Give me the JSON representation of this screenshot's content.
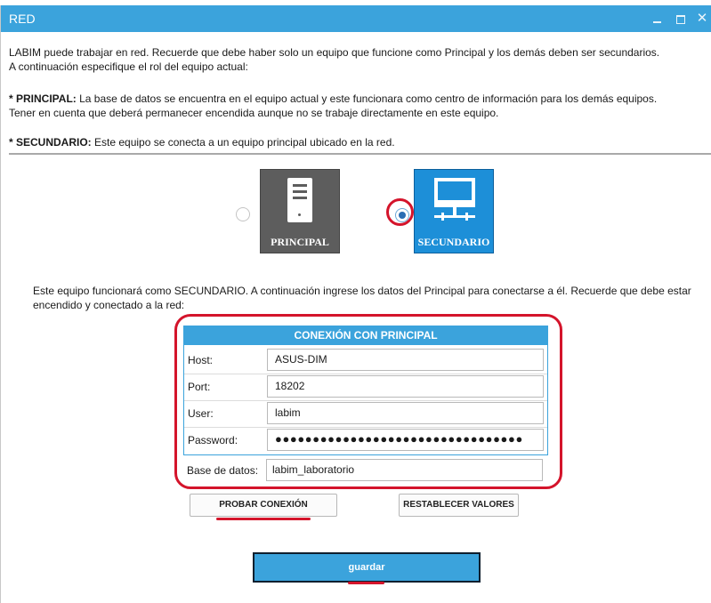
{
  "window": {
    "title": "RED",
    "minimize_icon": "minimize-icon",
    "maximize_icon": "maximize-icon",
    "close_label": "✕"
  },
  "intro": {
    "line1": "LABIM puede trabajar en red. Recuerde que debe haber solo un equipo que funcione como Principal y los demás deben ser secundarios.",
    "line2": "A continuación especifique el rol del equipo actual:"
  },
  "principal_desc": {
    "bold": "* PRINCIPAL:",
    "text1": " La base de datos se encuentra en el equipo actual y este funcionara como centro de información para los demás equipos.",
    "text2": "Tener en cuenta que deberá permanecer encendida aunque no se trabaje directamente en este equipo."
  },
  "secundario_desc": {
    "bold": "* SECUNDARIO:",
    "text": " Este equipo se conecta a un equipo principal ubicado en la red."
  },
  "roles": {
    "principal": {
      "label": "PRINCIPAL",
      "icon": "server-icon",
      "selected": false
    },
    "secundario": {
      "label": "SECUNDARIO",
      "icon": "monitor-network-icon",
      "selected": true
    }
  },
  "secondary_info": "Este equipo funcionará como SECUNDARIO. A continuación ingrese los datos del Principal para conectarse a él. Recuerde que debe estar encendido y conectado a la red:",
  "connection": {
    "header": "CONEXIÓN CON PRINCIPAL",
    "host_label": "Host:",
    "host_value": "ASUS-DIM",
    "port_label": "Port:",
    "port_value": "18202",
    "user_label": "User:",
    "user_value": "labim",
    "password_label": "Password:",
    "password_value": "●●●●●●●●●●●●●●●●●●●●●●●●●●●●●●●●●",
    "database_label": "Base de datos:",
    "database_value": "labim_laboratorio"
  },
  "buttons": {
    "probar": "PROBAR CONEXIÓN",
    "restablecer": "RESTABLECER VALORES",
    "guardar": "guardar"
  },
  "colors": {
    "accent": "#3ba3dc",
    "highlight": "#d4142b",
    "principal_card": "#5d5d5d",
    "secundario_card": "#1d8fd8"
  }
}
